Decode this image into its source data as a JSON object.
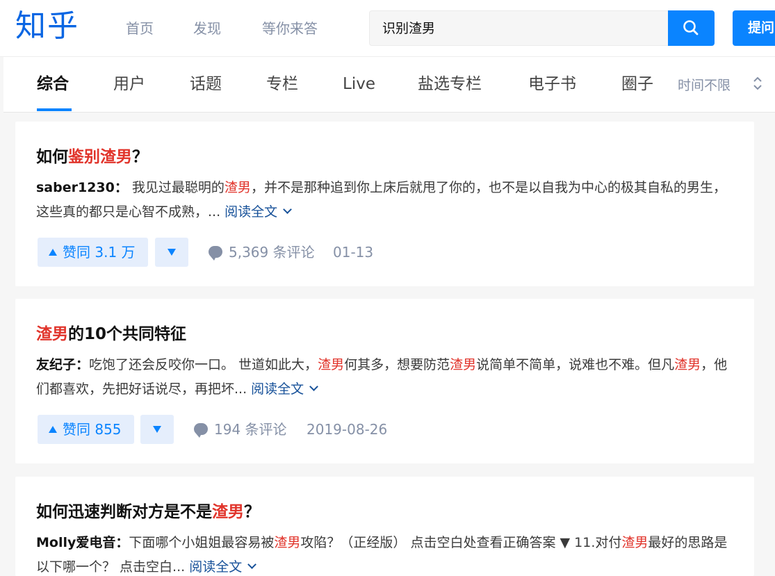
{
  "header": {
    "logo": "知乎",
    "nav": [
      "首页",
      "发现",
      "等你来答"
    ],
    "search_value": "识别渣男",
    "ask_label": "提问"
  },
  "tabs": [
    "综合",
    "用户",
    "话题",
    "专栏",
    "Live",
    "盐选专栏",
    "电子书",
    "圈子"
  ],
  "time_filter": "时间不限",
  "results": [
    {
      "title_pre": "如何",
      "title_hl": "鉴别渣男",
      "title_post": "？",
      "author": "saber1230：",
      "excerpt_parts": [
        " 我见过最聪明的",
        "渣男",
        "，并不是那种追到你上床后就甩了你的，也不是以自我为中心的极其自私的男生，这些真的都只是心智不成熟，... "
      ],
      "read_more": "阅读全文",
      "vote_label": "赞同 3.1 万",
      "comments": "5,369 条评论",
      "date": "01-13"
    },
    {
      "title_pre": "",
      "title_hl": "渣男",
      "title_post": "的10个共同特征",
      "author": "友纪子：",
      "excerpt_parts": [
        "吃饱了还会反咬你一口。 世道如此大，",
        "渣男",
        "何其多，想要防范",
        "渣男",
        "说简单不简单，说难也不难。但凡",
        "渣男",
        "，他们都喜欢，先把好话说尽，再把坏... "
      ],
      "read_more": "阅读全文",
      "vote_label": "赞同 855",
      "comments": "194 条评论",
      "date": "2019-08-26"
    },
    {
      "title_pre": "如何迅速判断对方是不是",
      "title_hl": "渣男",
      "title_post": "？",
      "author": "Molly爱电音：",
      "excerpt_parts": [
        "下面哪个小姐姐最容易被",
        "渣男",
        "攻陷？（正经版） 点击空白处查看正确答案 ▼ 11.对付",
        "渣男",
        "最好的思路是以下哪一个？ 点击空白... "
      ],
      "read_more": "阅读全文"
    }
  ],
  "colors": {
    "brand": "#0a84ff",
    "highlight": "#e1342b",
    "link": "#175199"
  }
}
